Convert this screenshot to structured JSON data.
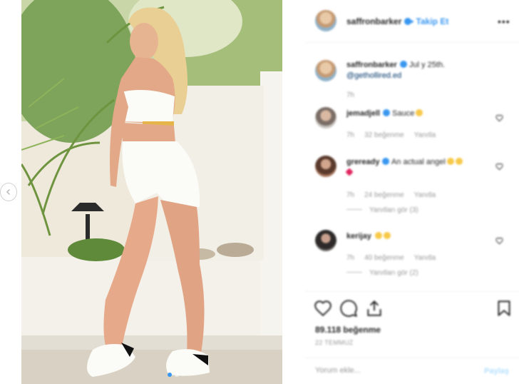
{
  "header": {
    "username": "saffronbarker",
    "separator": "•",
    "follow_label": "Takip Et",
    "more": "•••"
  },
  "caption": {
    "username": "saffronbarker",
    "text": "Jul y 25th.",
    "tag": "@gethollired.ed",
    "time": "7h"
  },
  "comments": [
    {
      "username": "jemadjell",
      "text": "Sauce",
      "time": "7h",
      "likes": "32 beğenme",
      "reply": "Yanıtla",
      "replies": ""
    },
    {
      "username": "greready",
      "text": "An actual angel",
      "time": "7h",
      "likes": "24 beğenme",
      "reply": "Yanıtla",
      "replies": "Yanıtları gör (3)"
    },
    {
      "username": "kerijay",
      "text": "",
      "time": "7h",
      "likes": "40 beğenme",
      "reply": "Yanıtla",
      "replies": "Yanıtları gör (2)"
    }
  ],
  "actions": {
    "likes_count": "89.118 beğenme",
    "date": "22 TEMMUZ"
  },
  "comment_box": {
    "placeholder": "Yorum ekle...",
    "post_label": "Paylaş"
  },
  "carousel": {
    "slides": 2,
    "active": 0
  },
  "colors": {
    "accent": "#3897f0",
    "text": "#262626",
    "muted": "#999999",
    "border": "#efefef"
  }
}
